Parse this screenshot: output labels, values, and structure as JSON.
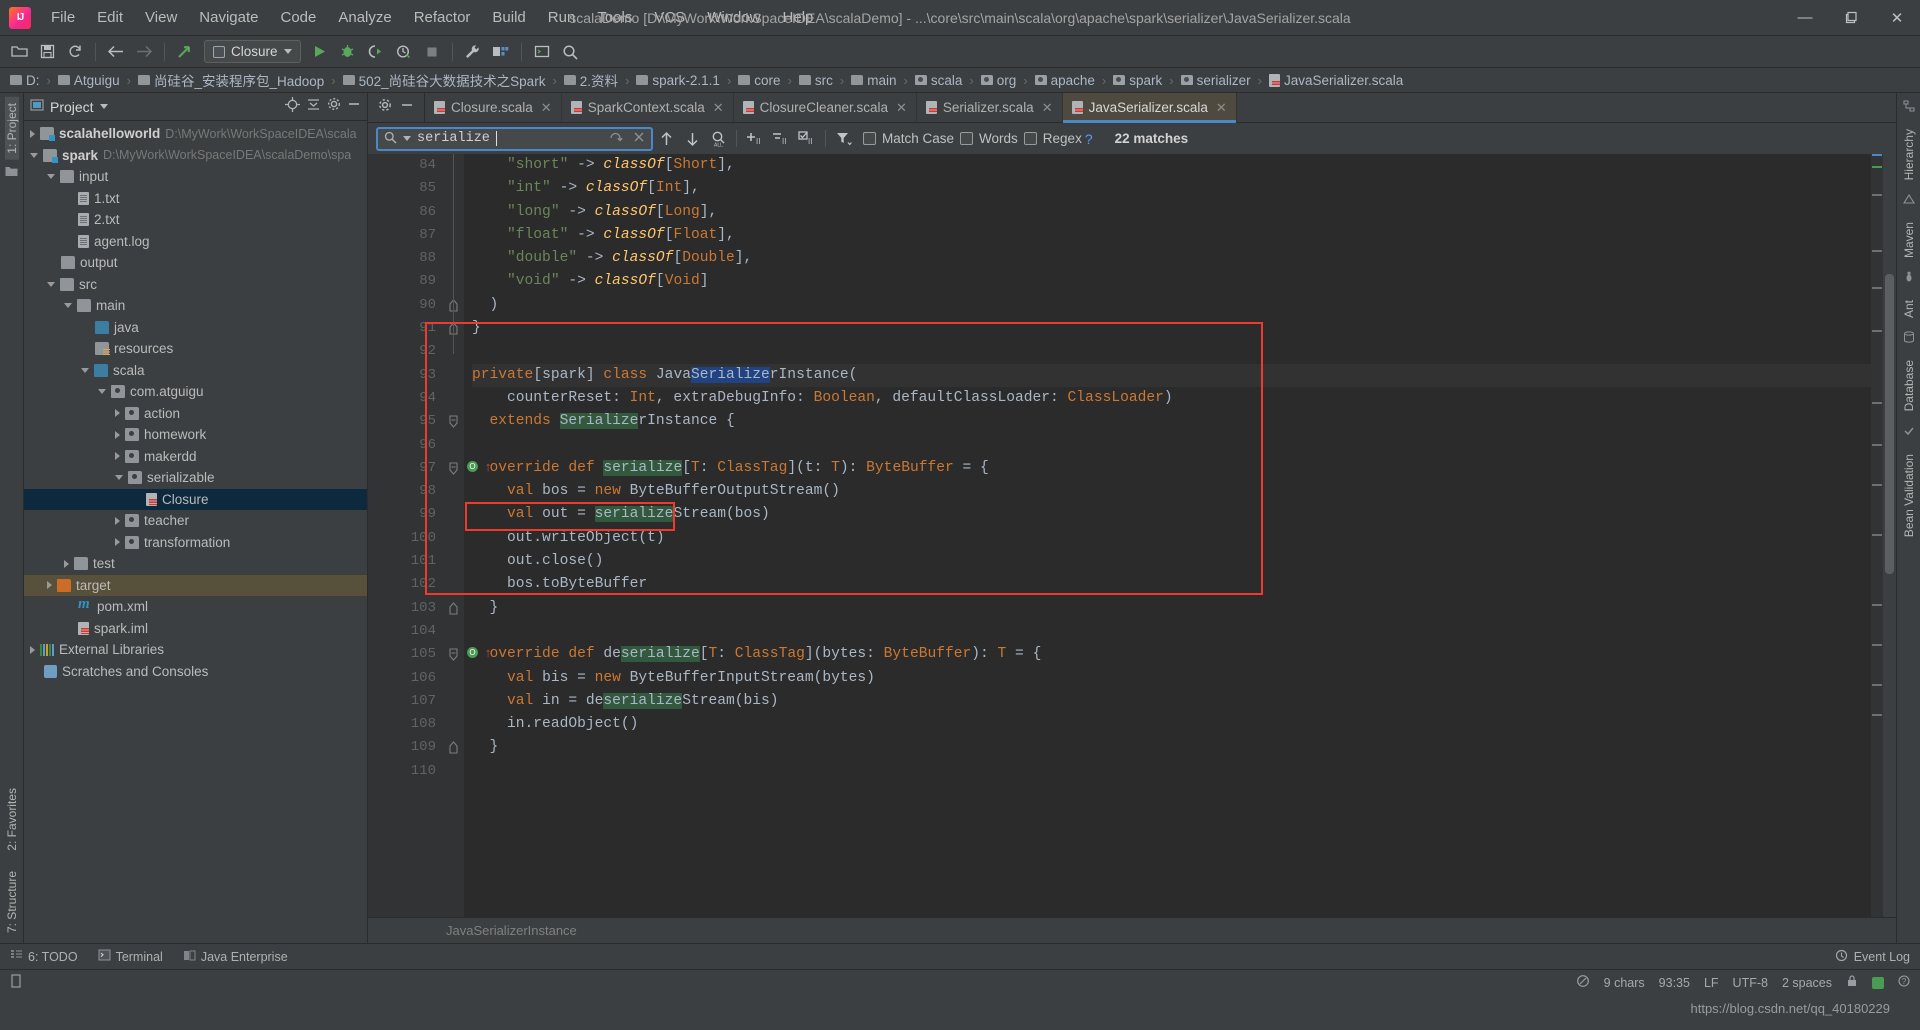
{
  "window": {
    "title": "scalaDemo [D:\\MyWork\\WorkSpaceIDEA\\scalaDemo] - ...\\core\\src\\main\\scala\\org\\apache\\spark\\serializer\\JavaSerializer.scala",
    "minimize": "—",
    "restore": "❐",
    "close": "✕"
  },
  "menu": [
    "File",
    "Edit",
    "View",
    "Navigate",
    "Code",
    "Analyze",
    "Refactor",
    "Build",
    "Run",
    "Tools",
    "VCS",
    "Window",
    "Help"
  ],
  "toolbar": {
    "run_config": "Closure",
    "icons": [
      "open-icon",
      "save-icon",
      "sync-icon",
      "back-icon",
      "forward-icon",
      "update-icon",
      "run-icon",
      "debug-icon",
      "run-coverage-icon",
      "profile-icon",
      "stop-icon",
      "settings-wrench-icon",
      "project-structure-icon",
      "terminal-icon",
      "search-everywhere-icon"
    ]
  },
  "breadcrumb": [
    {
      "label": "D:",
      "type": "folder"
    },
    {
      "label": "Atguigu",
      "type": "folder"
    },
    {
      "label": "尚硅谷_安装程序包_Hadoop",
      "type": "folder"
    },
    {
      "label": "502_尚硅谷大数据技术之Spark",
      "type": "folder"
    },
    {
      "label": "2.资料",
      "type": "folder"
    },
    {
      "label": "spark-2.1.1",
      "type": "folder"
    },
    {
      "label": "core",
      "type": "folder"
    },
    {
      "label": "src",
      "type": "folder"
    },
    {
      "label": "main",
      "type": "folder"
    },
    {
      "label": "scala",
      "type": "package"
    },
    {
      "label": "org",
      "type": "package"
    },
    {
      "label": "apache",
      "type": "package"
    },
    {
      "label": "spark",
      "type": "package"
    },
    {
      "label": "serializer",
      "type": "package"
    },
    {
      "label": "JavaSerializer.scala",
      "type": "scala"
    }
  ],
  "rails": {
    "left_top": "1: Project",
    "left_bottom_1": "7: Structure",
    "left_bottom_2": "2: Favorites",
    "right": [
      "Hierarchy",
      "Maven",
      "Ant",
      "Database",
      "Bean Validation"
    ]
  },
  "project_panel": {
    "title": "Project",
    "header_icons": [
      "locate-icon",
      "collapse-all-icon",
      "settings-gear-icon",
      "hide-icon"
    ],
    "tree": [
      {
        "indent": 0,
        "arrow": "right",
        "icon": "module",
        "label": "scalahelloworld",
        "bold": true,
        "path": "D:\\MyWork\\WorkSpaceIDEA\\scala"
      },
      {
        "indent": 0,
        "arrow": "down",
        "icon": "module",
        "label": "spark",
        "bold": true,
        "path": "D:\\MyWork\\WorkSpaceIDEA\\scalaDemo\\spa"
      },
      {
        "indent": 1,
        "arrow": "down",
        "icon": "folder",
        "label": "input",
        "bold": false,
        "path": ""
      },
      {
        "indent": 2,
        "arrow": "none",
        "icon": "text",
        "label": "1.txt",
        "bold": false,
        "path": ""
      },
      {
        "indent": 2,
        "arrow": "none",
        "icon": "text",
        "label": "2.txt",
        "bold": false,
        "path": ""
      },
      {
        "indent": 2,
        "arrow": "none",
        "icon": "text",
        "label": "agent.log",
        "bold": false,
        "path": ""
      },
      {
        "indent": 1,
        "arrow": "none",
        "icon": "folder",
        "label": "output",
        "bold": false,
        "path": ""
      },
      {
        "indent": 1,
        "arrow": "down",
        "icon": "folder",
        "label": "src",
        "bold": false,
        "path": ""
      },
      {
        "indent": 2,
        "arrow": "down",
        "icon": "folder",
        "label": "main",
        "bold": false,
        "path": ""
      },
      {
        "indent": 3,
        "arrow": "none",
        "icon": "folder-blue",
        "label": "java",
        "bold": false,
        "path": ""
      },
      {
        "indent": 3,
        "arrow": "none",
        "icon": "folder-res",
        "label": "resources",
        "bold": false,
        "path": ""
      },
      {
        "indent": 3,
        "arrow": "down",
        "icon": "folder-blue",
        "label": "scala",
        "bold": false,
        "path": ""
      },
      {
        "indent": 4,
        "arrow": "down",
        "icon": "package",
        "label": "com.atguigu",
        "bold": false,
        "path": ""
      },
      {
        "indent": 5,
        "arrow": "right",
        "icon": "package",
        "label": "action",
        "bold": false,
        "path": ""
      },
      {
        "indent": 5,
        "arrow": "right",
        "icon": "package",
        "label": "homework",
        "bold": false,
        "path": ""
      },
      {
        "indent": 5,
        "arrow": "right",
        "icon": "package",
        "label": "makerdd",
        "bold": false,
        "path": ""
      },
      {
        "indent": 5,
        "arrow": "down",
        "icon": "package",
        "label": "serializable",
        "bold": false,
        "path": ""
      },
      {
        "indent": 6,
        "arrow": "none",
        "icon": "scala",
        "label": "Closure",
        "bold": false,
        "path": "",
        "selected": true
      },
      {
        "indent": 5,
        "arrow": "right",
        "icon": "package",
        "label": "teacher",
        "bold": false,
        "path": ""
      },
      {
        "indent": 5,
        "arrow": "right",
        "icon": "package",
        "label": "transformation",
        "bold": false,
        "path": ""
      },
      {
        "indent": 2,
        "arrow": "right",
        "icon": "folder",
        "label": "test",
        "bold": false,
        "path": ""
      },
      {
        "indent": 1,
        "arrow": "right",
        "icon": "folder-orange",
        "label": "target",
        "bold": false,
        "path": "",
        "target": true
      },
      {
        "indent": 2,
        "arrow": "none",
        "icon": "maven",
        "label": "pom.xml",
        "bold": false,
        "path": ""
      },
      {
        "indent": 2,
        "arrow": "none",
        "icon": "scala",
        "label": "spark.iml",
        "bold": false,
        "path": ""
      },
      {
        "indent": 0,
        "arrow": "right",
        "icon": "libs",
        "label": "External Libraries",
        "bold": false,
        "path": ""
      },
      {
        "indent": 0,
        "arrow": "none",
        "icon": "scratch",
        "label": "Scratches and Consoles",
        "bold": false,
        "path": ""
      }
    ]
  },
  "tabs": [
    {
      "label": "Closure.scala",
      "active": false
    },
    {
      "label": "SparkContext.scala",
      "active": false
    },
    {
      "label": "ClosureCleaner.scala",
      "active": false
    },
    {
      "label": "Serializer.scala",
      "active": false
    },
    {
      "label": "JavaSerializer.scala",
      "active": true
    }
  ],
  "find": {
    "query": "serialize",
    "placeholder": "Search",
    "buttons": [
      "find-prev-icon",
      "find-next-icon",
      "find-all-icon",
      "add-line-selection-icon",
      "remove-line-selection-icon",
      "select-all-occurrences-icon",
      "filter-icon"
    ],
    "match_case": "Match Case",
    "words": "Words",
    "regex": "Regex",
    "help": "?",
    "matches": "22 matches",
    "reset_icon": "reset-icon",
    "close_icon": "close-icon"
  },
  "code": {
    "first_line": 84,
    "lines": [
      {
        "n": 84,
        "text": "    \"short\" -> classOf[Short],",
        "clipped": true
      },
      {
        "n": 85,
        "text": "    \"int\" -> classOf[Int],"
      },
      {
        "n": 86,
        "text": "    \"long\" -> classOf[Long],"
      },
      {
        "n": 87,
        "text": "    \"float\" -> classOf[Float],"
      },
      {
        "n": 88,
        "text": "    \"double\" -> classOf[Double],"
      },
      {
        "n": 89,
        "text": "    \"void\" -> classOf[Void]"
      },
      {
        "n": 90,
        "text": "  )"
      },
      {
        "n": 91,
        "text": "}"
      },
      {
        "n": 92,
        "text": ""
      },
      {
        "n": 93,
        "text": "private[spark] class JavaSerializerInstance("
      },
      {
        "n": 94,
        "text": "    counterReset: Int, extraDebugInfo: Boolean, defaultClassLoader: ClassLoader)"
      },
      {
        "n": 95,
        "text": "  extends SerializerInstance {"
      },
      {
        "n": 96,
        "text": ""
      },
      {
        "n": 97,
        "text": "  override def serialize[T: ClassTag](t: T): ByteBuffer = {"
      },
      {
        "n": 98,
        "text": "    val bos = new ByteBufferOutputStream()"
      },
      {
        "n": 99,
        "text": "    val out = serializeStream(bos)"
      },
      {
        "n": 100,
        "text": "    out.writeObject(t)"
      },
      {
        "n": 101,
        "text": "    out.close()"
      },
      {
        "n": 102,
        "text": "    bos.toByteBuffer"
      },
      {
        "n": 103,
        "text": "  }"
      },
      {
        "n": 104,
        "text": ""
      },
      {
        "n": 105,
        "text": "  override def deserialize[T: ClassTag](bytes: ByteBuffer): T = {"
      },
      {
        "n": 106,
        "text": "    val bis = new ByteBufferInputStream(bytes)"
      },
      {
        "n": 107,
        "text": "    val in = deserializeStream(bis)"
      },
      {
        "n": 108,
        "text": "    in.readObject()"
      },
      {
        "n": 109,
        "text": "  }"
      },
      {
        "n": 110,
        "text": ""
      }
    ]
  },
  "editor_footer": "JavaSerializerInstance",
  "toolwindows": [
    {
      "label": "6: TODO",
      "icon": "todo-icon"
    },
    {
      "label": "Terminal",
      "icon": "terminal-icon"
    },
    {
      "label": "Java Enterprise",
      "icon": "java-enterprise-icon"
    }
  ],
  "event_log": "Event Log",
  "status": {
    "chars": "9 chars",
    "position": "93:35",
    "line_sep": "LF",
    "encoding": "UTF-8",
    "indent": "2 spaces",
    "lock_icon": "lock-icon",
    "inspection_icon": "inspection-icon"
  },
  "watermark": "https://blog.csdn.net/qq_40180229",
  "colors": {
    "accent": "#4a88c7",
    "annotation_red": "#ef3b2d",
    "match_highlight": "#32593d",
    "selection": "#214283",
    "keyword": "#cc7832",
    "string": "#6a8759",
    "class_name": "#ffc66d",
    "editor_bg": "#2b2b2b",
    "ui_bg": "#3c3f41"
  }
}
